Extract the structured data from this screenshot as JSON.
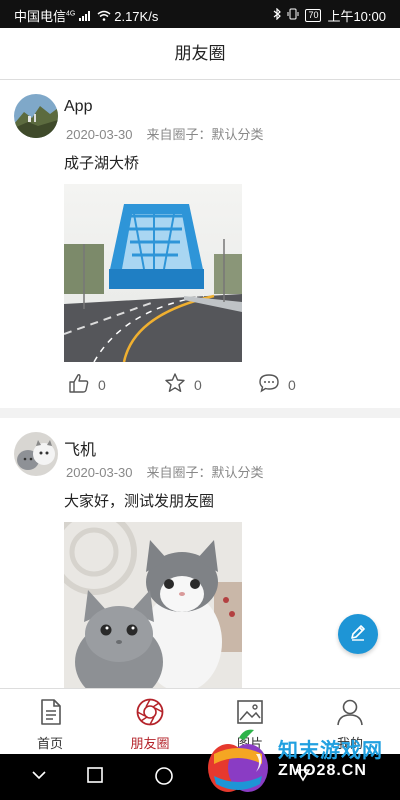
{
  "status_bar": {
    "carrier": "中国电信",
    "signal_type": "4G",
    "speed": "2.17K/s",
    "battery": "70",
    "time": "上午10:00"
  },
  "header": {
    "title": "朋友圈"
  },
  "posts": [
    {
      "username": "App",
      "date": "2020-03-30",
      "source": "来自圈子：默认分类",
      "text": "成子湖大桥",
      "image": "bridge-photo",
      "like_count": "0",
      "favorite_count": "0",
      "comment_count": "0"
    },
    {
      "username": "飞机",
      "date": "2020-03-30",
      "source": "来自圈子：默认分类",
      "text": "大家好，测试发朋友圈",
      "image": "kittens-photo"
    }
  ],
  "tabs": [
    {
      "label": "首页",
      "icon": "document-icon"
    },
    {
      "label": "朋友圈",
      "icon": "camera-aperture-icon",
      "active": true
    },
    {
      "label": "图片",
      "icon": "picture-icon"
    },
    {
      "label": "我的",
      "icon": "person-icon"
    }
  ],
  "watermark": {
    "line1": "知末游戏网",
    "line2": "ZMO28.CN"
  },
  "colors": {
    "accent": "#b4232a",
    "fab": "#1e95d6",
    "watermark_blue": "#21a0e0"
  }
}
